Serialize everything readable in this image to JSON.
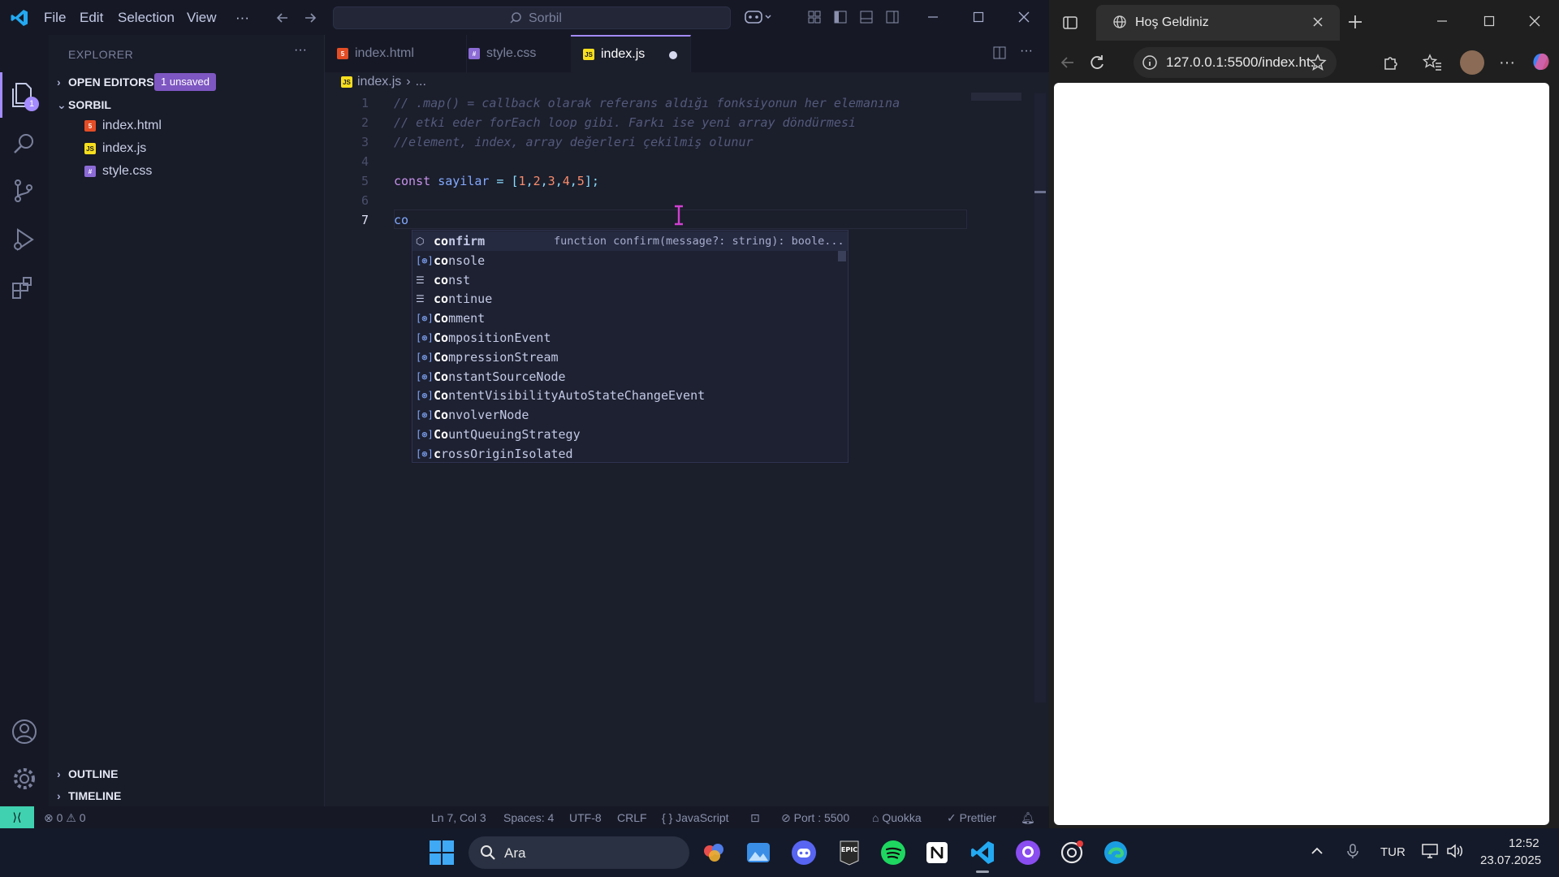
{
  "vscode": {
    "menu": [
      "File",
      "Edit",
      "Selection",
      "View",
      "···"
    ],
    "command_center": "Sorbil",
    "explorer_title": "EXPLORER",
    "open_editors": "OPEN EDITORS",
    "unsaved_badge": "1 unsaved",
    "folder": "SORBIL",
    "files": [
      {
        "name": "index.html",
        "type": "html"
      },
      {
        "name": "index.js",
        "type": "js"
      },
      {
        "name": "style.css",
        "type": "css"
      }
    ],
    "outline": "OUTLINE",
    "timeline": "TIMELINE",
    "activity_badge": "1",
    "tabs": [
      {
        "label": "index.html",
        "type": "html"
      },
      {
        "label": "style.css",
        "type": "css"
      },
      {
        "label": "index.js",
        "type": "js"
      }
    ],
    "breadcrumb": [
      "index.js",
      "..."
    ],
    "code": {
      "line_numbers": [
        "1",
        "2",
        "3",
        "4",
        "5",
        "6",
        "7"
      ],
      "line1": "// .map() = callback olarak referans aldığı fonksiyonun her elemanına",
      "line2": "// etki eder forEach loop gibi. Farkı ise yeni array döndürmesi",
      "line3": "//element, index, array değerleri çekilmiş olunur",
      "line5_kw": "const",
      "line5_var": "sayilar",
      "line5_eq": " = ",
      "line5_open": "[",
      "line5_nums": [
        "1",
        "2",
        "3",
        "4",
        "5"
      ],
      "line5_close": "];",
      "line7": "co"
    },
    "suggestions": [
      {
        "match": "co",
        "rest": "nfirm",
        "kind": "method",
        "detail": "function confirm(message?: string): boole..."
      },
      {
        "match": "co",
        "rest": "nsole",
        "kind": "variable"
      },
      {
        "match": "co",
        "rest": "nst",
        "kind": "keyword"
      },
      {
        "match": "co",
        "rest": "ntinue",
        "kind": "keyword"
      },
      {
        "match": "Co",
        "rest": "mment",
        "kind": "variable"
      },
      {
        "match": "Co",
        "rest": "mpositionEvent",
        "kind": "variable"
      },
      {
        "match": "Co",
        "rest": "mpressionStream",
        "kind": "variable"
      },
      {
        "match": "Co",
        "rest": "nstantSourceNode",
        "kind": "variable"
      },
      {
        "match": "Co",
        "rest": "ntentVisibilityAutoStateChangeEvent",
        "kind": "variable"
      },
      {
        "match": "Co",
        "rest": "nvolverNode",
        "kind": "variable"
      },
      {
        "match": "Co",
        "rest": "untQueuingStrategy",
        "kind": "variable"
      },
      {
        "match": "c",
        "rest": "rossOriginIsolated",
        "kind": "variable"
      }
    ],
    "status": {
      "errors": "0",
      "warnings": "0",
      "position": "Ln 7, Col 3",
      "spaces": "Spaces: 4",
      "encoding": "UTF-8",
      "eol": "CRLF",
      "language": "JavaScript",
      "port": "Port : 5500",
      "quokka": "Quokka",
      "prettier": "Prettier"
    }
  },
  "browser": {
    "tab_title": "Hoş Geldiniz",
    "url": "127.0.0.1:5500/index.ht..."
  },
  "taskbar": {
    "search": "Ara",
    "lang": "TUR",
    "time": "12:52",
    "date": "23.07.2025"
  },
  "colors": {
    "accent": "#a48bff",
    "remote": "#3fd1b0",
    "badge": "#7e57c2"
  }
}
